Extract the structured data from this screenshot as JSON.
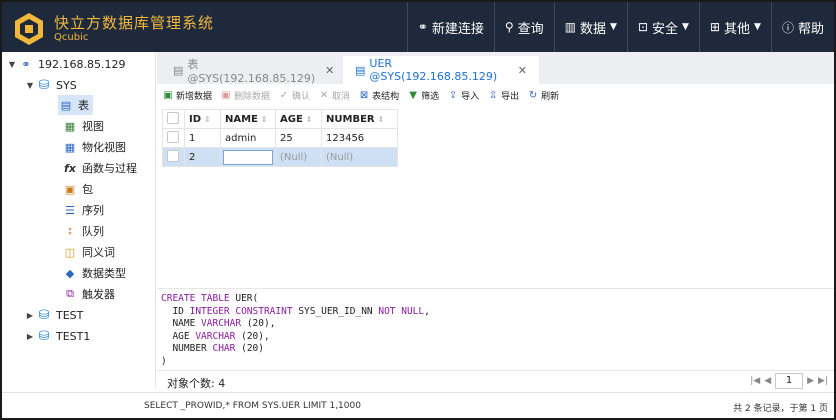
{
  "app": {
    "title": "快立方数据库管理系统",
    "subtitle": "Qcubic",
    "accent_color": "#f0b73a",
    "header_bg": "#1e2a3c"
  },
  "nav": [
    {
      "icon": "link-icon",
      "glyph": "🔗︎",
      "label": "新建连接"
    },
    {
      "icon": "search-icon",
      "glyph": "⌕",
      "label": "查询"
    },
    {
      "icon": "chart-icon",
      "glyph": "▦",
      "label": "数据",
      "dropdown": true
    },
    {
      "icon": "lock-icon",
      "glyph": "🔒︎",
      "label": "安全",
      "dropdown": true
    },
    {
      "icon": "grid-icon",
      "glyph": "▦",
      "label": "其他",
      "dropdown": true
    },
    {
      "icon": "help-icon",
      "glyph": "?",
      "label": "帮助"
    }
  ],
  "tree": {
    "connection": "192.168.85.129",
    "schemas": [
      {
        "name": "SYS",
        "expanded": true
      },
      {
        "name": "TEST",
        "expanded": false
      },
      {
        "name": "TEST1",
        "expanded": false
      }
    ],
    "sys_children": [
      {
        "icon": "table-icon",
        "label": "表",
        "selected": true
      },
      {
        "icon": "view-icon",
        "label": "视图"
      },
      {
        "icon": "materialized-view-icon",
        "label": "物化视图"
      },
      {
        "icon": "function-icon",
        "label": "函数与过程"
      },
      {
        "icon": "package-icon",
        "label": "包"
      },
      {
        "icon": "sequence-icon",
        "label": "序列"
      },
      {
        "icon": "queue-icon",
        "label": "队列"
      },
      {
        "icon": "synonym-icon",
        "label": "同义词"
      },
      {
        "icon": "datatype-icon",
        "label": "数据类型"
      },
      {
        "icon": "trigger-icon",
        "label": "触发器"
      }
    ]
  },
  "tabs": [
    {
      "label": "表 @SYS(192.168.85.129)",
      "active": false
    },
    {
      "label": "UER @SYS(192.168.85.129)",
      "active": true
    }
  ],
  "toolbar": [
    {
      "icon": "add-data-icon",
      "label": "新增数据",
      "enabled": true
    },
    {
      "icon": "delete-data-icon",
      "label": "删除数据",
      "enabled": false
    },
    {
      "icon": "confirm-icon",
      "label": "确认",
      "enabled": false
    },
    {
      "icon": "cancel-icon",
      "label": "取消",
      "enabled": false
    },
    {
      "icon": "table-structure-icon",
      "label": "表结构",
      "enabled": true
    },
    {
      "icon": "filter-icon",
      "label": "筛选",
      "enabled": true
    },
    {
      "icon": "import-icon",
      "label": "导入",
      "enabled": true
    },
    {
      "icon": "export-icon",
      "label": "导出",
      "enabled": true
    },
    {
      "icon": "refresh-icon",
      "label": "刷新",
      "enabled": true
    }
  ],
  "grid": {
    "columns": [
      "ID",
      "NAME",
      "AGE",
      "NUMBER"
    ],
    "rows": [
      {
        "id": "1",
        "name": "admin",
        "age": "25",
        "number": "123456"
      },
      {
        "id": "2",
        "name": "",
        "age": "(Null)",
        "number": "(Null)"
      }
    ]
  },
  "ddl": {
    "line1_kw": "CREATE TABLE",
    "line1_rest": " UER(",
    "id_col": "  ID ",
    "id_type": "INTEGER CONSTRAINT",
    "id_rest1": " SYS_UER_ID_NN ",
    "id_kw2": "NOT NULL",
    "id_rest2": ",",
    "name_col": "  NAME ",
    "name_type": "VARCHAR",
    "name_rest": " (20),",
    "age_col": "  AGE ",
    "age_type": "VARCHAR",
    "age_rest": " (20),",
    "num_col": "  NUMBER ",
    "num_type": "CHAR",
    "num_rest": " (20)",
    "close": ")"
  },
  "footer": {
    "object_count_label": "对象个数:  4",
    "page": "1",
    "sql": "SELECT _PROWID,* FROM SYS.UER LIMIT 1,1000",
    "summary": "共 2 条记录，于第 1 页"
  }
}
